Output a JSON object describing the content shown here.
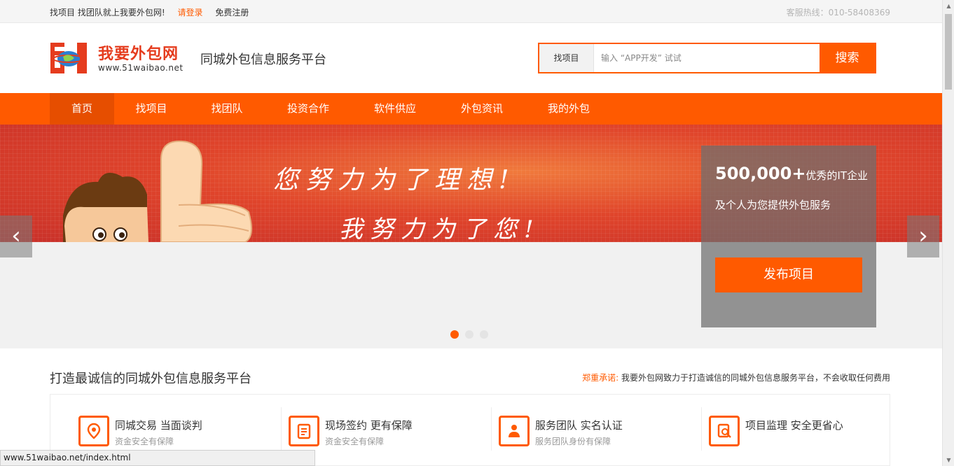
{
  "topbar": {
    "tagline": "找项目 找团队就上我要外包网!",
    "login": "请登录",
    "register": "免费注册",
    "hotline": "客服热线：010-58408369"
  },
  "header": {
    "logo_cn": "我要外包网",
    "logo_url": "www.51waibao.net",
    "slogan": "同城外包信息服务平台"
  },
  "search": {
    "type_label": "找项目",
    "placeholder": "输入 “APP开发” 试试",
    "button": "搜索"
  },
  "nav": {
    "items": [
      {
        "label": "首页"
      },
      {
        "label": "找项目"
      },
      {
        "label": "找团队"
      },
      {
        "label": "投资合作"
      },
      {
        "label": "软件供应"
      },
      {
        "label": "外包资讯"
      },
      {
        "label": "我的外包"
      }
    ]
  },
  "banner": {
    "line1": "您努力为了理想!",
    "line2": "我努力为了您!",
    "prev": "‹",
    "next": "›"
  },
  "promo": {
    "count": "500,000+",
    "count_suffix": "优秀的IT企业",
    "desc": "及个人为您提供外包服务",
    "publish": "发布项目"
  },
  "section": {
    "title": "打造最诚信的同城外包信息服务平台",
    "promise_tag": "郑重承诺:",
    "promise_text": "我要外包网致力于打造诚信的同城外包信息服务平台，不会收取任何费用"
  },
  "features": [
    {
      "title": "同城交易 当面谈判",
      "sub": "资金安全有保障",
      "icon": "location-pin-icon"
    },
    {
      "title": "现场签约 更有保障",
      "sub": "资金安全有保障",
      "icon": "contract-icon"
    },
    {
      "title": "服务团队 实名认证",
      "sub": "服务团队身份有保障",
      "icon": "team-icon"
    },
    {
      "title": "项目监理 安全更省心",
      "sub": "",
      "icon": "supervision-icon"
    }
  ],
  "statusbar": {
    "url": "www.51waibao.net/index.html"
  },
  "colors": {
    "accent": "#ff5a00",
    "nav_active": "#e64e00",
    "banner_red": "#e0452b"
  }
}
